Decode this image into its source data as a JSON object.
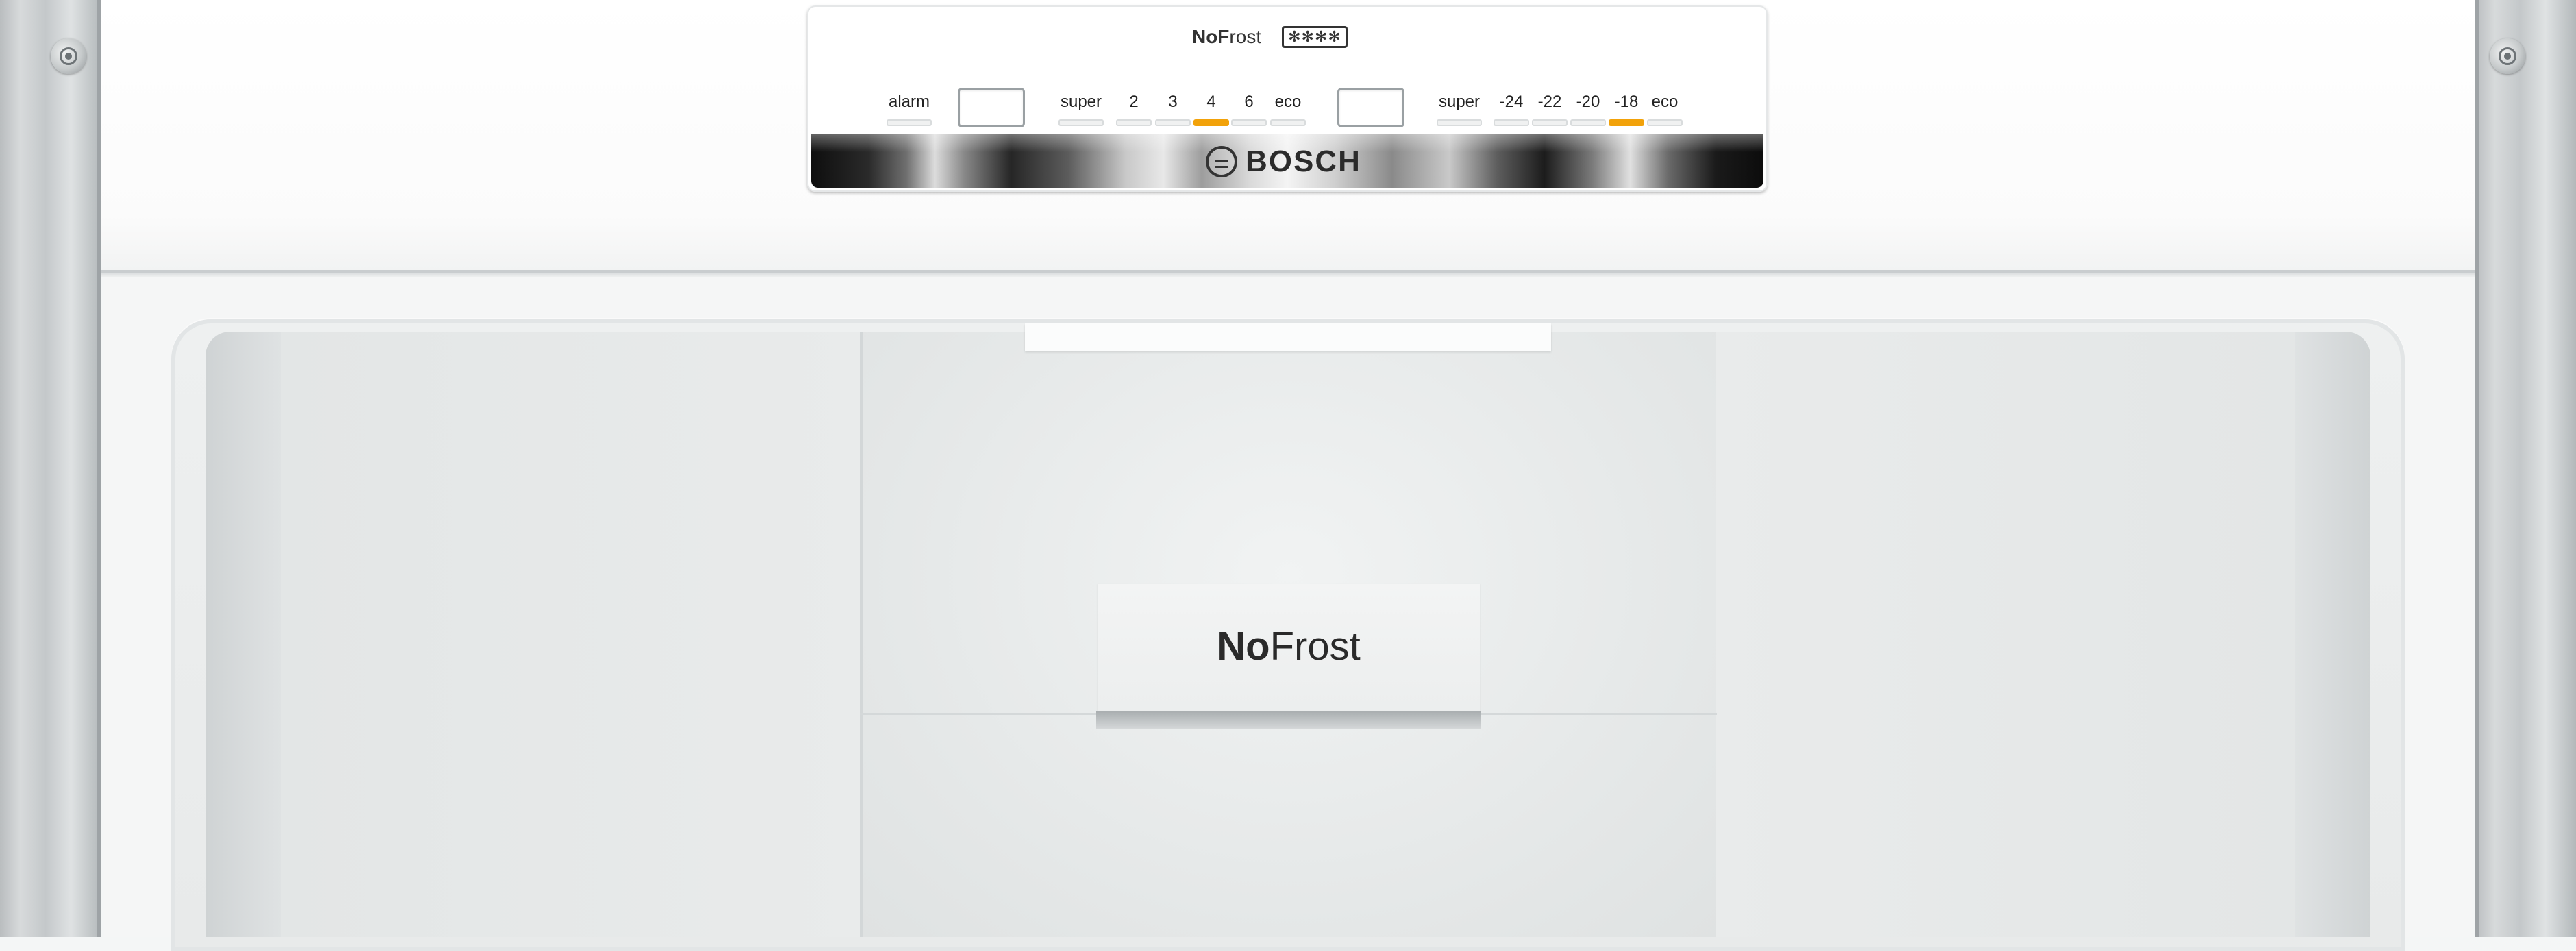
{
  "panel": {
    "brand_bold": "No",
    "brand_rest": "Frost",
    "star_rating": "✻✻✻✻",
    "logo_text": "BOSCH",
    "alarm_label": "alarm",
    "fridge": {
      "labels": [
        "super",
        "2",
        "3",
        "4",
        "6",
        "eco"
      ],
      "active": "4"
    },
    "freezer": {
      "labels": [
        "super",
        "-24",
        "-22",
        "-20",
        "-18",
        "eco"
      ],
      "active": "-18"
    }
  },
  "interior": {
    "badge_bold": "No",
    "badge_rest": "Frost"
  },
  "colors": {
    "indicator_on": "#f2a20a",
    "trim_steel": "#c4c8ca",
    "chrome_dark": "#0e0e0e"
  },
  "icons": [
    "screw-icon",
    "bosch-logo-icon",
    "star-rating-icon"
  ]
}
